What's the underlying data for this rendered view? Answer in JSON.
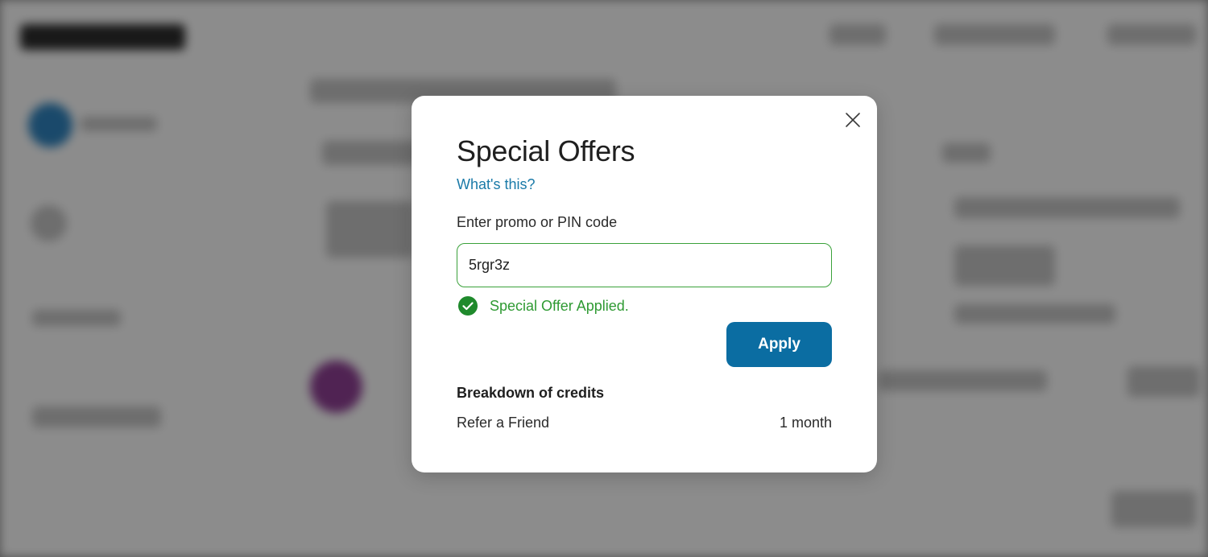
{
  "modal": {
    "title": "Special Offers",
    "help_link": "What's this?",
    "field_label": "Enter promo or PIN code",
    "promo_value": "5rgr3z",
    "success_message": "Special Offer Applied.",
    "apply_label": "Apply",
    "breakdown_title": "Breakdown of credits",
    "credits": [
      {
        "name": "Refer a Friend",
        "amount": "1 month"
      }
    ],
    "icons": {
      "close": "close-icon",
      "success": "check-circle-icon"
    }
  },
  "colors": {
    "accent": "#0b6da2",
    "link": "#1a7aa8",
    "success": "#2f9a33",
    "input_border": "#3aa13a"
  }
}
